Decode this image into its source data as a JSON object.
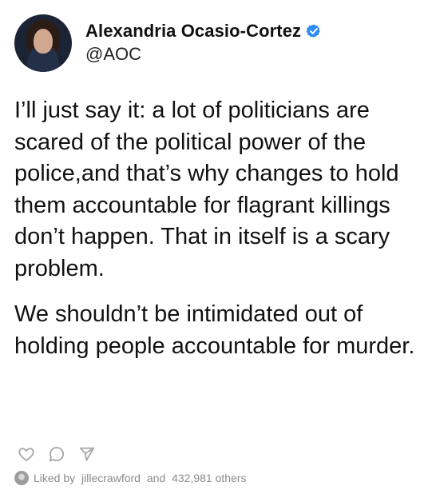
{
  "post": {
    "author": {
      "name": "Alexandria Ocasio-Cortez",
      "handle": "@AOC",
      "avatar_icon": "profile-photo",
      "verified_icon": "verified-badge-icon",
      "verified_color": "#2f8cf0"
    },
    "body": {
      "paragraph_1": "I’ll just say it: a lot of politicians are scared of the political power of the police,and that’s why changes to hold them accountable for flagrant killings don’t happen. That in itself is a scary problem.",
      "paragraph_2": "We shouldn’t be intimidated out of holding people accountable for murder."
    },
    "actions": {
      "like_icon": "heart-icon",
      "comment_icon": "comment-icon",
      "share_icon": "send-icon"
    },
    "likes": {
      "prefix": "Liked by",
      "user": "jillecrawford",
      "connector": "and",
      "others": "432,981 others",
      "avatar_icon": "liked-user-avatar"
    }
  }
}
